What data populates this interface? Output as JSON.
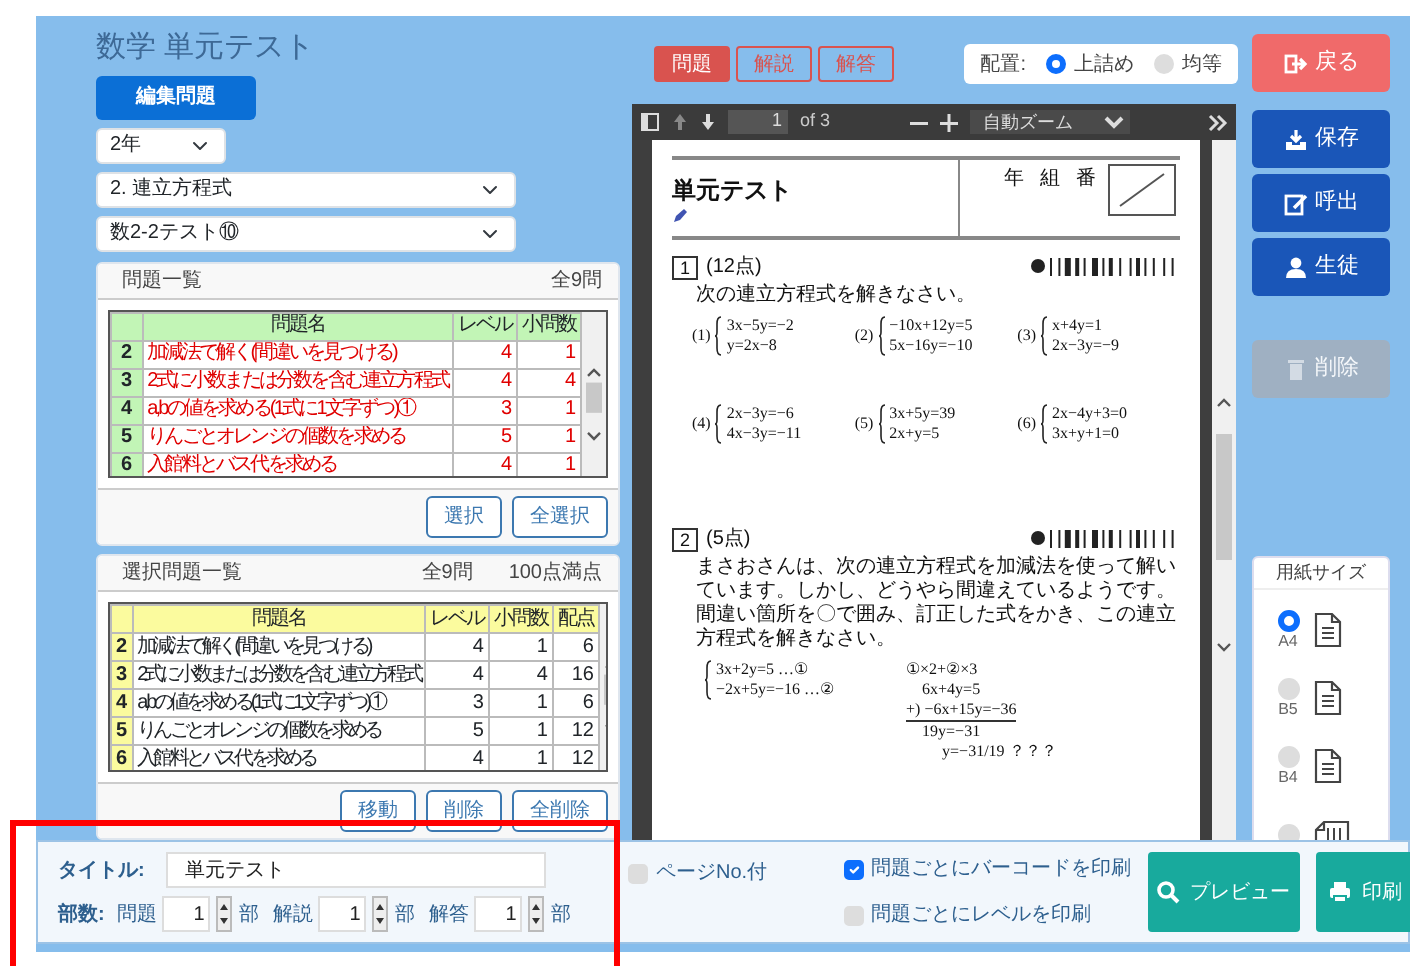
{
  "header": {
    "title": "数学 単元テスト",
    "edit_button": "編集問題"
  },
  "selects": [
    {
      "value": "2年"
    },
    {
      "value": "2. 連立方程式"
    },
    {
      "value": "数2-2テスト⑩"
    }
  ],
  "problem_list": {
    "title": "問題一覧",
    "count": "全9問",
    "columns": [
      "問題名",
      "レベル",
      "小問数"
    ],
    "rows": [
      {
        "no": "2",
        "name": "加減法で解く(間違いを見つける)",
        "level": "4",
        "count": "1"
      },
      {
        "no": "3",
        "name": "2式に小数または分数を含む連立方程式",
        "level": "4",
        "count": "4"
      },
      {
        "no": "4",
        "name": "a,bの値を求める(1式に1文字ずつ)①",
        "level": "3",
        "count": "1"
      },
      {
        "no": "5",
        "name": "りんごとオレンジの個数を求める",
        "level": "5",
        "count": "1"
      },
      {
        "no": "6",
        "name": "入館料とバス代を求める",
        "level": "4",
        "count": "1"
      }
    ],
    "buttons": [
      "選択",
      "全選択"
    ]
  },
  "selected_list": {
    "title": "選択問題一覧",
    "count": "全9問",
    "total": "100点満点",
    "columns": [
      "問題名",
      "レベル",
      "小問数",
      "配点"
    ],
    "rows": [
      {
        "no": "2",
        "name": "加減法で解く(間違いを見つける)",
        "level": "4",
        "count": "1",
        "points": "6"
      },
      {
        "no": "3",
        "name": "2式に小数または分数を含む連立方程式",
        "level": "4",
        "count": "4",
        "points": "16"
      },
      {
        "no": "4",
        "name": "a,bの値を求める(1式に1文字ずつ)①",
        "level": "3",
        "count": "1",
        "points": "6"
      },
      {
        "no": "5",
        "name": "りんごとオレンジの個数を求める",
        "level": "5",
        "count": "1",
        "points": "12"
      },
      {
        "no": "6",
        "name": "入館料とバス代を求める",
        "level": "4",
        "count": "1",
        "points": "12"
      }
    ],
    "buttons": [
      "移動",
      "削除",
      "全削除"
    ]
  },
  "view_tabs": [
    {
      "label": "問題",
      "selected": true
    },
    {
      "label": "解説",
      "selected": false
    },
    {
      "label": "解答",
      "selected": false
    }
  ],
  "layout_option": {
    "label": "配置:",
    "options": [
      {
        "label": "上詰め",
        "selected": true
      },
      {
        "label": "均等",
        "selected": false
      }
    ]
  },
  "viewer": {
    "page": "1",
    "page_total": "of 3",
    "zoom": "自動ズーム",
    "document": {
      "title": "単元テスト",
      "name_marks": [
        "年",
        "組",
        "番"
      ],
      "problems": [
        {
          "kind": "systems",
          "number": "1",
          "points": "(12点)",
          "text": "次の連立方程式を解きなさい。",
          "equations": [
            {
              "label": "(1)",
              "lines": [
                "3x−5y=−2",
                "y=2x−8"
              ]
            },
            {
              "label": "(2)",
              "lines": [
                "−10x+12y=5",
                "5x−16y=−10"
              ]
            },
            {
              "label": "(3)",
              "lines": [
                "x+4y=1",
                "2x−3y=−9"
              ]
            },
            {
              "label": "(4)",
              "lines": [
                "2x−3y=−6",
                "4x−3y=−11"
              ]
            },
            {
              "label": "(5)",
              "lines": [
                "3x+5y=39",
                "2x+y=5"
              ]
            },
            {
              "label": "(6)",
              "lines": [
                "2x−4y+3=0",
                "3x+y+1=0"
              ]
            }
          ]
        },
        {
          "kind": "correction",
          "number": "2",
          "points": "(5点)",
          "text": "まさおさんは、次の連立方程式を加減法を使って解いています。しかし、どうやら間違えているようです。間違い箇所を〇で囲み、訂正した式をかき、この連立方程式を解きなさい。",
          "system": [
            "3x+2y=5 …①",
            "−2x+5y=−16 …②"
          ],
          "work": [
            "①×2+②×3",
            "6x+4y=5",
            "+) −6x+15y=−36",
            "19y=−31",
            "y=−31/19 ？？？"
          ]
        }
      ]
    }
  },
  "side_buttons": [
    {
      "label": "戻る",
      "kind": "back",
      "disabled": false
    },
    {
      "label": "保存",
      "kind": "save",
      "disabled": false
    },
    {
      "label": "呼出",
      "kind": "open",
      "disabled": false
    },
    {
      "label": "生徒",
      "kind": "student",
      "disabled": false
    },
    {
      "label": "削除",
      "kind": "delete",
      "disabled": true
    }
  ],
  "paper_size": {
    "title": "用紙サイズ",
    "options": [
      {
        "label": "A4",
        "kind": "portrait",
        "selected": true
      },
      {
        "label": "B5",
        "kind": "portrait",
        "selected": false
      },
      {
        "label": "B4",
        "kind": "portrait",
        "selected": false
      },
      {
        "kind": "landscape",
        "selected": false
      }
    ]
  },
  "bottom": {
    "title_label": "タイトル:",
    "title_value": "単元テスト",
    "copies_label": "部数:",
    "copies": [
      {
        "label": "問題",
        "value": "1",
        "unit": "部"
      },
      {
        "label": "解説",
        "value": "1",
        "unit": "部"
      },
      {
        "label": "解答",
        "value": "1",
        "unit": "部"
      }
    ],
    "options": [
      {
        "label": "ページNo.付",
        "checked": false
      },
      {
        "label": "問題ごとにバーコードを印刷",
        "checked": true
      },
      {
        "label": "問題ごとにレベルを印刷",
        "checked": false
      }
    ],
    "buttons": [
      {
        "label": "プレビュー",
        "kind": "preview"
      },
      {
        "label": "印刷",
        "kind": "print"
      }
    ]
  }
}
